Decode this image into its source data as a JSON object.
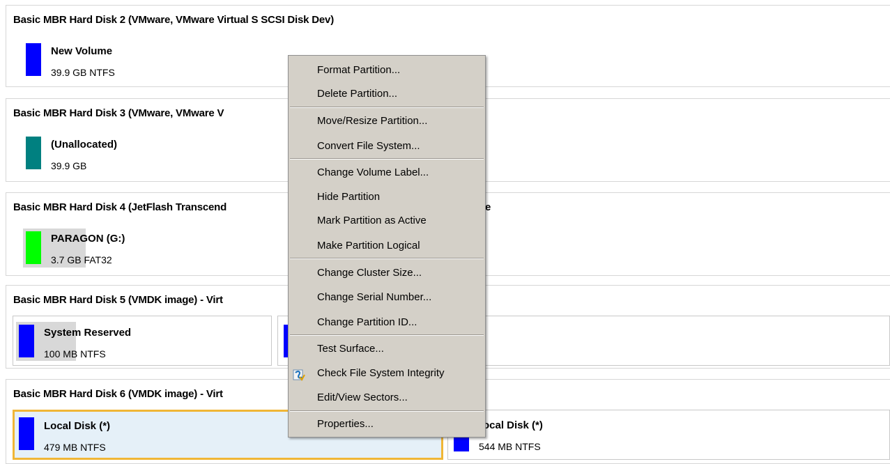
{
  "disks": [
    {
      "title": "Basic MBR Hard Disk 2 (VMware, VMware Virtual S SCSI Disk Dev)",
      "partitions": [
        {
          "name": "New Volume",
          "info": "39.9 GB NTFS",
          "color": "#0000ff"
        }
      ]
    },
    {
      "title": "Basic MBR Hard Disk 3 (VMware, VMware V",
      "partitions": [
        {
          "name": "(Unallocated)",
          "info": "39.9 GB",
          "color": "#008080"
        }
      ]
    },
    {
      "title": "Basic MBR Hard Disk 4 (JetFlash Transcend",
      "title_tail": "e",
      "partitions": [
        {
          "name": "PARAGON (G:)",
          "info": "3.7 GB FAT32",
          "color": "#00ff00"
        }
      ]
    },
    {
      "title": "Basic MBR Hard Disk 5 (VMDK image) - Virt",
      "partitions": [
        {
          "name": "System Reserved",
          "info": "100 MB NTFS",
          "color": "#0000ff"
        },
        {
          "name": "",
          "info": "",
          "color": "#0000ff"
        }
      ]
    },
    {
      "title": "Basic MBR Hard Disk 6 (VMDK image) - Virt",
      "partitions": [
        {
          "name": "Local Disk (*)",
          "info": "479 MB NTFS",
          "color": "#0000ff"
        },
        {
          "name": "ocal Disk (*)",
          "info": "544 MB NTFS",
          "color": "#0000ff"
        }
      ]
    }
  ],
  "context_menu": {
    "items": [
      "Format Partition...",
      "Delete Partition...",
      "Move/Resize Partition...",
      "Convert File System...",
      "Change Volume Label...",
      "Hide Partition",
      "Mark Partition as Active",
      "Make Partition Logical",
      "Change Cluster Size...",
      "Change Serial Number...",
      "Change Partition ID...",
      "Test Surface...",
      "Check File System Integrity",
      "Edit/View Sectors...",
      "Properties..."
    ],
    "check_icon": "check-file-system-icon"
  },
  "colors": {
    "selection_border": "#f0b636",
    "selection_fill": "#e5f0f8",
    "menu_background": "#d4d0c8"
  }
}
